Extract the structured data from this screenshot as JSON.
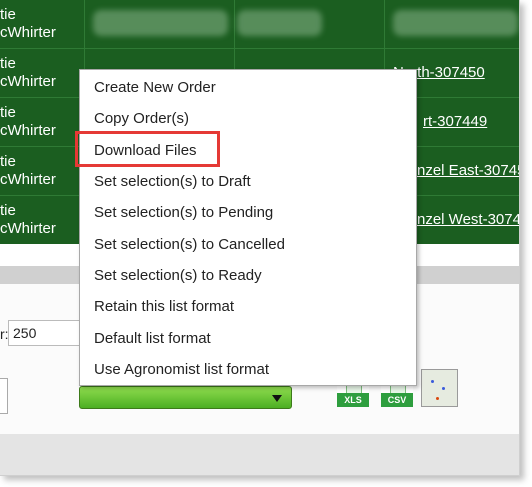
{
  "table": {
    "rows": [
      {
        "name_line1": "tie",
        "name_line2": "",
        "link": ""
      },
      {
        "name_line1": "tie",
        "name_line2": "cWhirter",
        "link": "North-307450"
      },
      {
        "name_line1": "tie",
        "name_line2": "cWhirter",
        "link": "rt-307449"
      },
      {
        "name_line1": "tie",
        "name_line2": "cWhirter",
        "link": "nzel East-30745"
      },
      {
        "name_line1": "tie",
        "name_line2": "cWhirter",
        "link": "nzel West-30745"
      }
    ],
    "row0_name_line2": "cWhirter"
  },
  "context_menu": {
    "items": [
      "Create New Order",
      "Copy Order(s)",
      "Download Files",
      "Set selection(s) to Draft",
      "Set selection(s) to Pending",
      "Set selection(s) to Cancelled",
      "Set selection(s) to Ready",
      "Retain this list format",
      "Default list format",
      "Use Agronomist list format"
    ],
    "highlighted_item": "Download Files"
  },
  "controls": {
    "page_size_label": "r:",
    "page_size_value": "250"
  },
  "exports": {
    "xls_label": "XLS",
    "csv_label": "CSV",
    "xls_icon": "excel-icon",
    "csv_icon": "csv-icon",
    "map_icon": "map-icon"
  },
  "colors": {
    "grid_background": "#1b5e20",
    "highlight_border": "#e53935",
    "action_select": "#4caf23"
  }
}
